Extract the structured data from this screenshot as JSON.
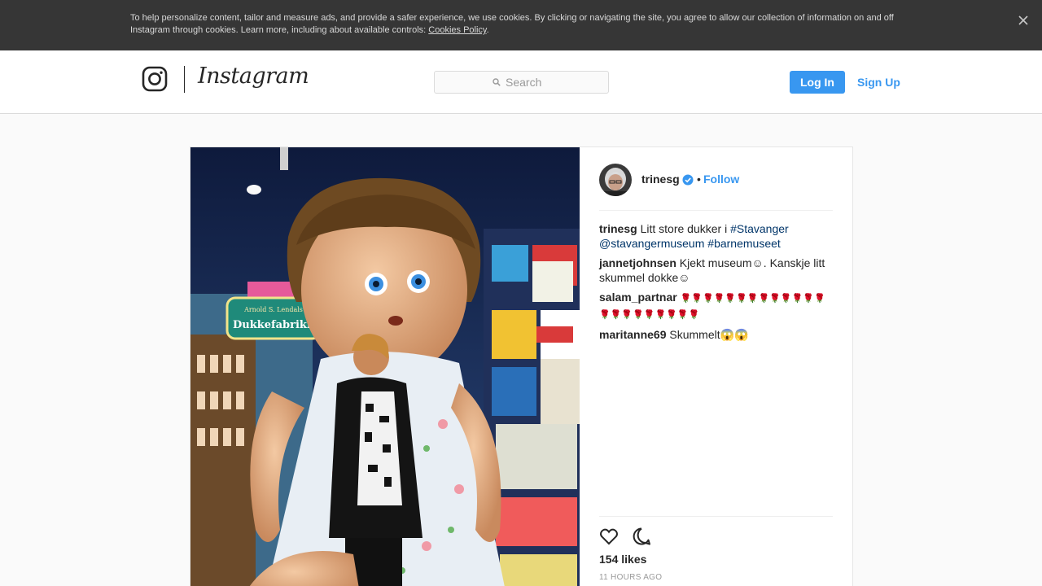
{
  "cookie_banner": {
    "text": "To help personalize content, tailor and measure ads, and provide a safer experience, we use cookies. By clicking or navigating the site, you agree to allow our collection of information on and off Instagram through cookies. Learn more, including about available controls: ",
    "link": "Cookies Policy",
    "period": "."
  },
  "header": {
    "wordmark": "Instagram",
    "search_placeholder": "Search",
    "login_label": "Log In",
    "signup_label": "Sign Up"
  },
  "post": {
    "username": "trinesg",
    "follow_label": "Follow",
    "dot": "•",
    "photo_sign": {
      "line1": "Arnold S. Lendals",
      "line2": "Dukkefabrikk"
    },
    "caption": {
      "user": "trinesg",
      "text": "Litt store dukker i ",
      "tag1": "#Stavanger",
      "tag2": "@stavangermuseum",
      "tag3": "#barnemuseet"
    },
    "comments": [
      {
        "user": "jannetjohnsen",
        "text": "Kjekt museum☺. Kanskje litt skummel dokke☺"
      },
      {
        "user": "salam_partnar",
        "text": "🌹🌹🌹🌹🌹🌹🌹🌹🌹🌹🌹🌹🌹🌹🌹🌹🌹🌹🌹🌹🌹🌹"
      },
      {
        "user": "maritanne69",
        "text": "Skummelt😱😱"
      }
    ],
    "likes": "154 likes",
    "timestamp": "11 HOURS AGO"
  },
  "icons": {
    "close": "close-icon",
    "logo": "instagram-glyph-icon",
    "search": "search-icon",
    "verified": "verified-badge-icon",
    "like": "heart-icon",
    "comment": "comment-bubble-icon"
  },
  "colors": {
    "accent": "#3897f0",
    "banner_bg": "#363636",
    "hashtag": "#003569"
  }
}
